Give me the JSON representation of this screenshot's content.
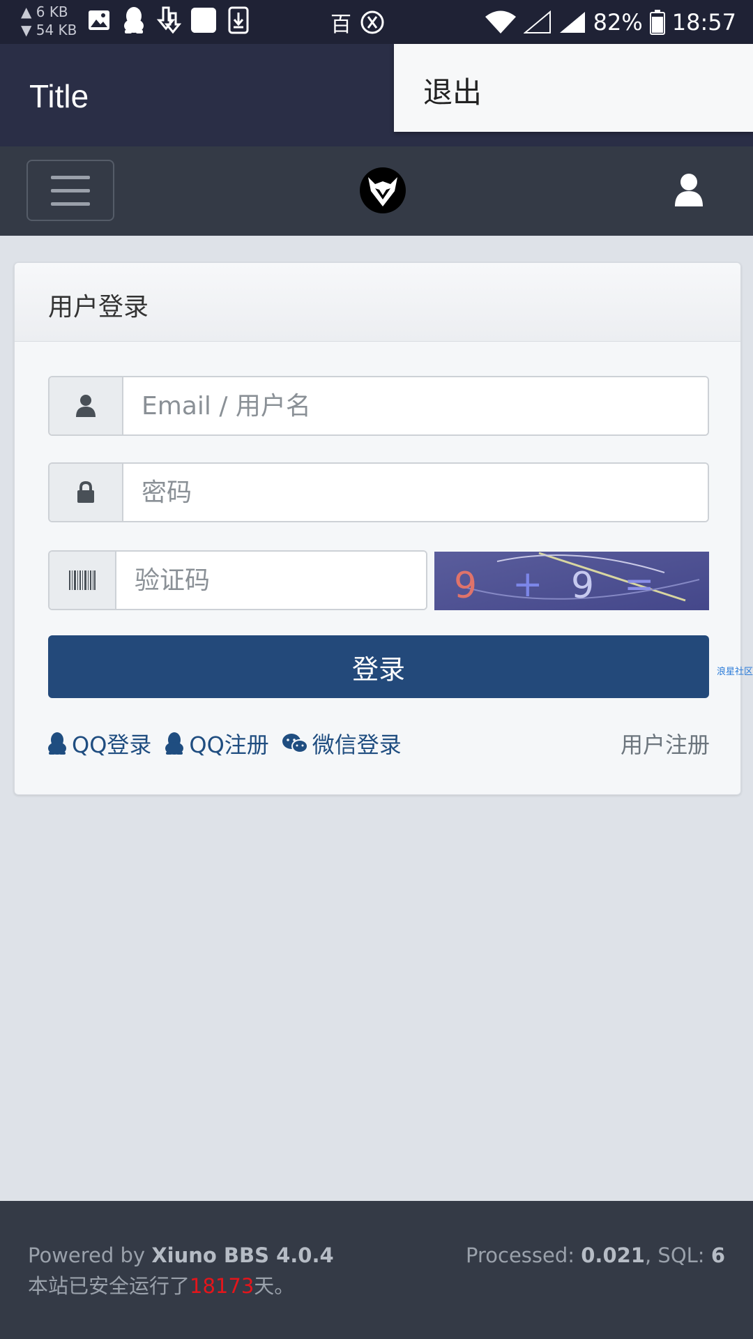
{
  "status_bar": {
    "upload_speed": "▲ 6 KB",
    "download_speed": "▼ 54 KB",
    "center_text": "百",
    "battery": "82%",
    "time": "18:57"
  },
  "app_bar": {
    "title": "Title"
  },
  "overflow_menu": {
    "items": [
      {
        "label": "退出"
      }
    ]
  },
  "navbar": {
    "menu_icon": "hamburger-icon",
    "logo_icon": "xiuno-logo",
    "user_icon": "user-icon"
  },
  "login_card": {
    "title": "用户登录",
    "username_placeholder": "Email / 用户名",
    "password_placeholder": "密码",
    "captcha_placeholder": "验证码",
    "captcha_text": "9 + 9 =",
    "submit_label": "登录",
    "social": [
      {
        "label": "QQ登录",
        "icon": "qq-icon"
      },
      {
        "label": "QQ注册",
        "icon": "qq-icon"
      },
      {
        "label": "微信登录",
        "icon": "wechat-icon"
      }
    ],
    "register_label": "用户注册"
  },
  "side_tag": "浪星社区",
  "footer": {
    "powered_prefix": "Powered by ",
    "powered_name": "Xiuno BBS 4.0.4",
    "uptime_prefix": " 本站已安全运行了",
    "uptime_days": "18173",
    "uptime_suffix": "天。",
    "processed_label": "Processed: ",
    "processed_value": "0.021",
    "sql_label": ", SQL: ",
    "sql_value": "6"
  },
  "colors": {
    "status_bar_bg": "#1f2235",
    "app_bar_bg": "#2a2e46",
    "navbar_bg": "#343a46",
    "primary_button": "#23497a",
    "link": "#1f4d80",
    "days_highlight": "#e4151b"
  }
}
